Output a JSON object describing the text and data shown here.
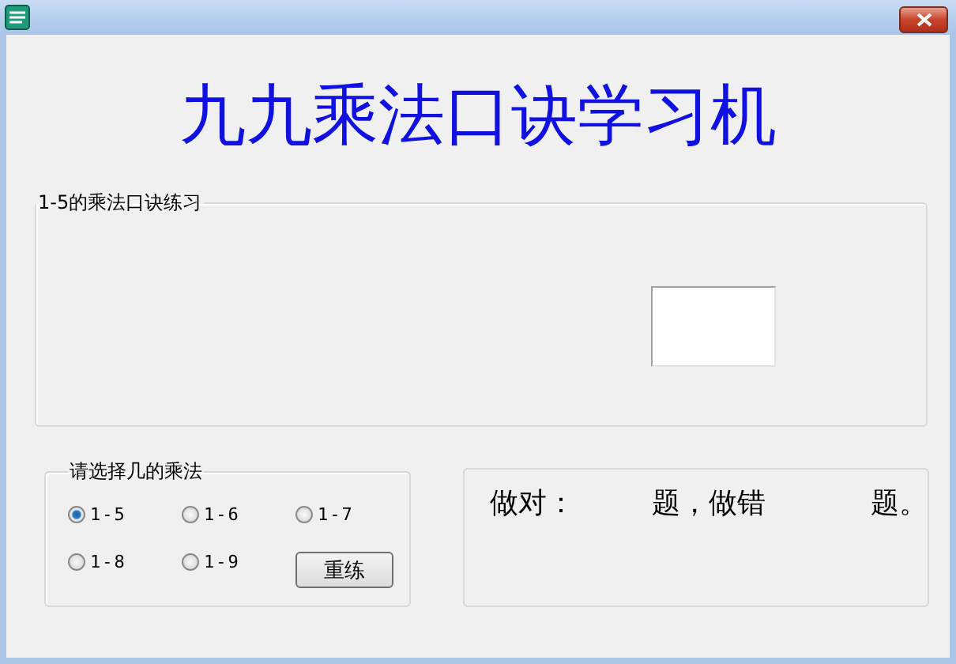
{
  "heading": "九九乘法口诀学习机",
  "practice_group": {
    "label": "1-5的乘法口诀练习"
  },
  "selection_group": {
    "label": "请选择几的乘法",
    "options": [
      {
        "label": "1-5",
        "selected": true
      },
      {
        "label": "1-6",
        "selected": false
      },
      {
        "label": "1-7",
        "selected": false
      },
      {
        "label": "1-8",
        "selected": false
      },
      {
        "label": "1-9",
        "selected": false
      }
    ],
    "button": "重练"
  },
  "score": {
    "texts": [
      "做对：",
      "题，做错",
      "题。"
    ]
  }
}
